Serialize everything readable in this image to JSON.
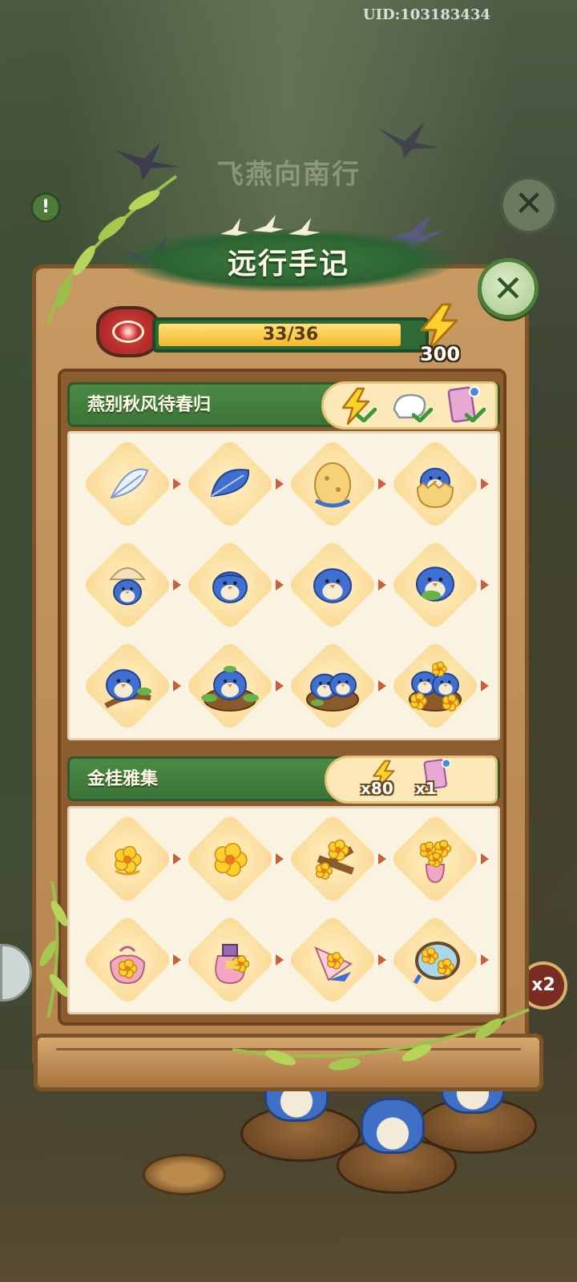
{
  "uid_text": "UID:103183434",
  "background": {
    "title": "飞燕向南行"
  },
  "header": {
    "title": "远行手记"
  },
  "progress": {
    "current": 33,
    "total": 36,
    "text": "33/36"
  },
  "energy": {
    "count": "300",
    "icon": "lightning-icon"
  },
  "sections": [
    {
      "title": "燕别秋风待春归",
      "rewards": [
        {
          "icon": "lightning-icon",
          "claimed": true
        },
        {
          "icon": "glove-icon",
          "claimed": true
        },
        {
          "icon": "card-icon",
          "claimed": true
        }
      ],
      "items": [
        "feather-icon",
        "blue-feather-icon",
        "egg-icon",
        "hatching-egg-icon",
        "shell-chick-icon",
        "sleeping-chick-icon",
        "sitting-swallow-icon",
        "swallow-with-leaf-icon",
        "swallow-on-branch-icon",
        "swallow-in-leafy-nest-icon",
        "swallows-in-nest-icon",
        "swallows-in-flower-nest-icon"
      ]
    },
    {
      "title": "金桂雅集",
      "rewards": [
        {
          "icon": "lightning-icon",
          "amount": "x80"
        },
        {
          "icon": "card-icon",
          "amount": "x1"
        }
      ],
      "items": [
        "osmanthus-flower-icon",
        "osmanthus-bloom-icon",
        "osmanthus-branch-icon",
        "osmanthus-vase-icon",
        "flower-pouch-icon",
        "flower-jar-icon",
        "flower-fan-icon",
        "flower-mirror-icon"
      ]
    }
  ],
  "colors": {
    "panel_wood": "#c89a63",
    "section_green": "#3b7436",
    "progress_fill": "#f2b82c",
    "cell_bg": "#f9d892"
  }
}
